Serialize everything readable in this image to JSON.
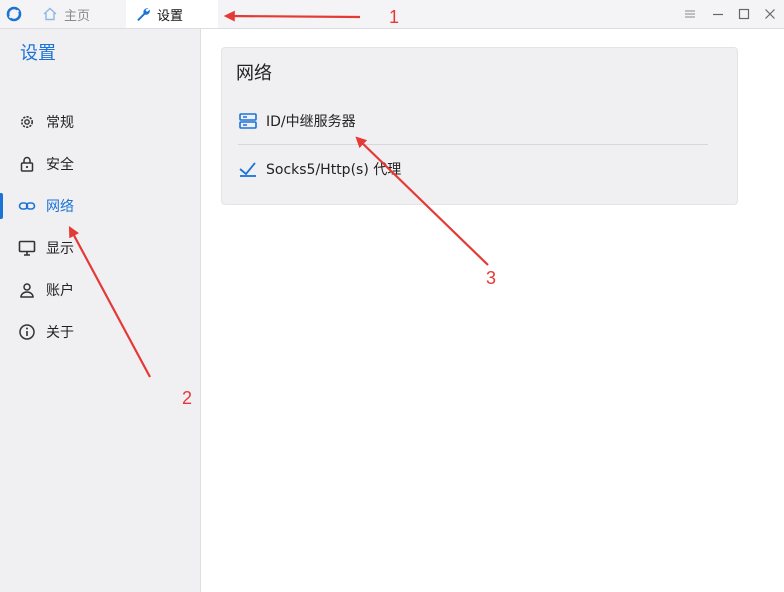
{
  "titlebar": {
    "tabs": [
      {
        "label": "主页",
        "icon": "home-icon"
      },
      {
        "label": "设置",
        "icon": "wrench-icon"
      }
    ],
    "controls": [
      "menu-icon",
      "minimize-icon",
      "maximize-icon",
      "close-icon"
    ]
  },
  "sidebar": {
    "title": "设置",
    "items": [
      {
        "label": "常规",
        "icon": "gear-icon"
      },
      {
        "label": "安全",
        "icon": "lock-icon"
      },
      {
        "label": "网络",
        "icon": "link-icon",
        "active": true
      },
      {
        "label": "显示",
        "icon": "monitor-icon"
      },
      {
        "label": "账户",
        "icon": "user-icon"
      },
      {
        "label": "关于",
        "icon": "info-icon"
      }
    ]
  },
  "main": {
    "card_title": "网络",
    "rows": [
      {
        "label": "ID/中继服务器",
        "icon": "server-icon"
      },
      {
        "label": "Socks5/Http(s) 代理",
        "icon": "proxy-icon"
      }
    ]
  },
  "annotations": [
    "1",
    "2",
    "3"
  ],
  "colors": {
    "accent": "#1b73d6",
    "annotation": "#e53935",
    "sidebar_bg": "#f0f0f2"
  }
}
